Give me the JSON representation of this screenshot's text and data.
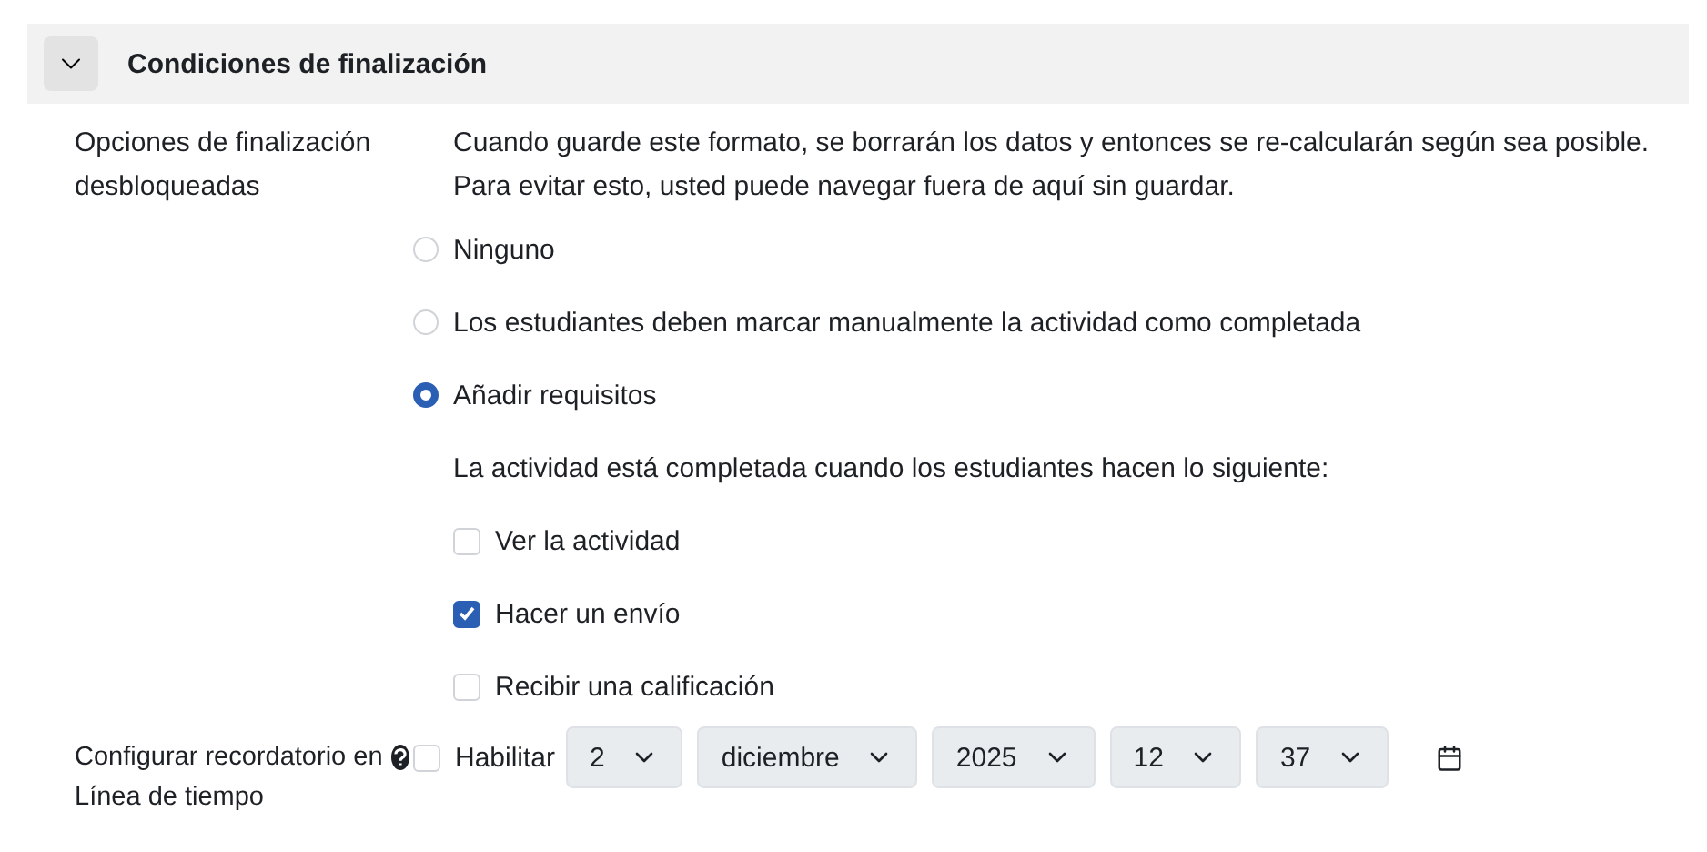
{
  "section": {
    "title": "Condiciones de finalización",
    "expanded": true
  },
  "completion": {
    "label": "Opciones de finalización desbloqueadas",
    "notice": [
      "Cuando guarde este formato, se borrarán los datos y entonces se re-calcularán según sea posible.",
      "Para evitar esto, usted puede navegar fuera de aquí sin guardar."
    ],
    "options": [
      {
        "label": "Ninguno",
        "selected": false
      },
      {
        "label": "Los estudiantes deben marcar manualmente la actividad como completada",
        "selected": false
      },
      {
        "label": "Añadir requisitos",
        "selected": true
      }
    ],
    "intro": "La actividad está completada cuando los estudiantes hacen lo siguiente:",
    "requirements": [
      {
        "label": "Ver la actividad",
        "checked": false
      },
      {
        "label": "Hacer un envío",
        "checked": true
      },
      {
        "label": "Recibir una calificación",
        "checked": false
      }
    ]
  },
  "reminder": {
    "label": "Configurar recordatorio en Línea de tiempo",
    "enable": {
      "label": "Habilitar",
      "checked": false
    },
    "selects": [
      {
        "value": "2"
      },
      {
        "value": "diciembre"
      },
      {
        "value": "2025"
      },
      {
        "value": "12"
      },
      {
        "value": "37"
      }
    ]
  }
}
